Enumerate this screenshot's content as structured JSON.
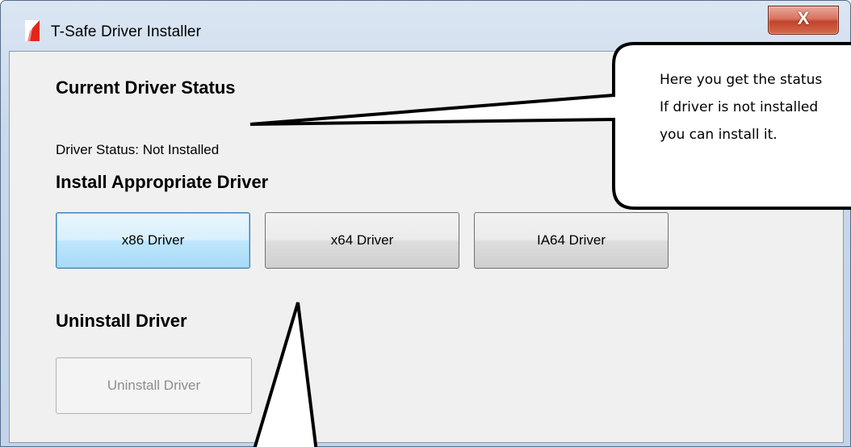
{
  "window": {
    "title": "T-Safe Driver Installer",
    "close_label": "X"
  },
  "status_section": {
    "heading": "Current Driver Status",
    "status_text": "Driver Status: Not Installed"
  },
  "install_section": {
    "heading": "Install Appropriate Driver",
    "buttons": [
      {
        "label": "x86 Driver"
      },
      {
        "label": "x64 Driver"
      },
      {
        "label": "IA64 Driver"
      }
    ]
  },
  "uninstall_section": {
    "heading": "Uninstall Driver",
    "button_label": "Uninstall Driver"
  },
  "callout": {
    "lines": [
      "Here you get the status",
      "If driver is not installed",
      "you can install it."
    ]
  },
  "icons": {
    "app": "red-flag-icon",
    "close": "close-icon"
  },
  "colors": {
    "close_button": "#c1442b",
    "focus_border": "#3c7fb1",
    "disabled_text": "#8d8d8d"
  }
}
